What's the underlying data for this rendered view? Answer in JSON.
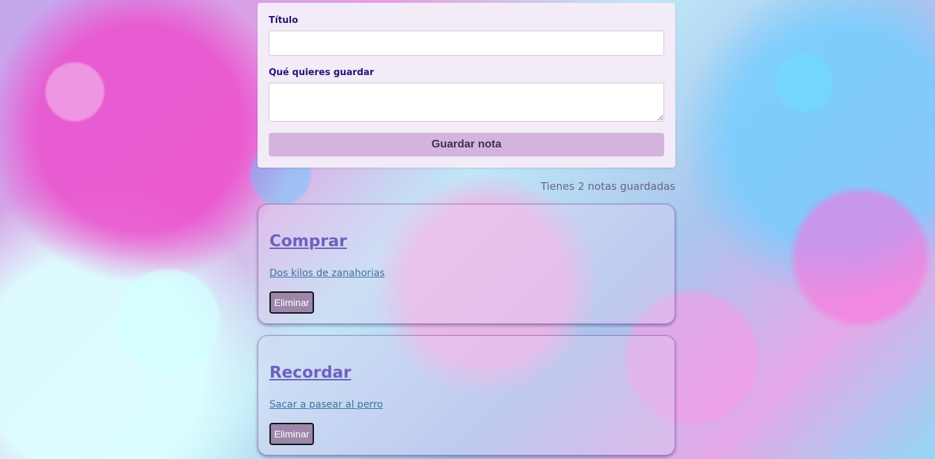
{
  "form": {
    "title_label": "Título",
    "title_value": "",
    "content_label": "Qué quieres guardar",
    "content_value": "",
    "save_label": "Guardar nota"
  },
  "notes_summary": "Tienes 2 notas guardadas",
  "notes": [
    {
      "title": "Comprar",
      "body": "Dos kilos de zanahorias",
      "delete_label": "Eliminar"
    },
    {
      "title": "Recordar",
      "body": "Sacar a pasear al perro",
      "delete_label": "Eliminar"
    }
  ],
  "colors": {
    "form_background": "#f4ebf8",
    "accent_button": "#d4b4dd",
    "note_title": "#7060bd",
    "note_body": "#3d739d",
    "delete_button": "#9c86a9"
  }
}
